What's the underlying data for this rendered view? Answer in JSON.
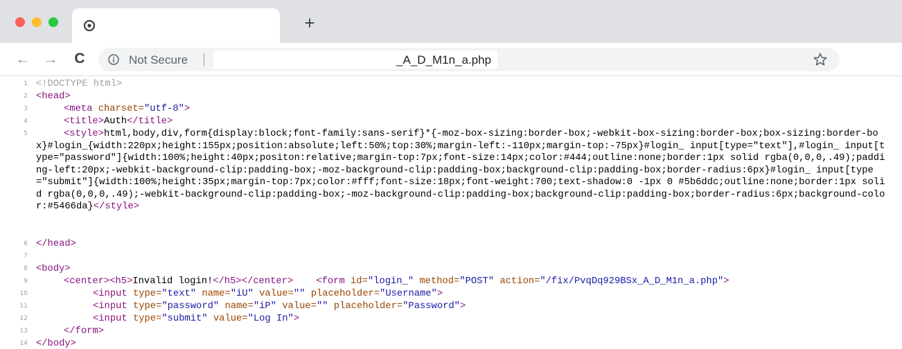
{
  "browser": {
    "new_tab_label": "+",
    "not_secure": "Not Secure",
    "url": "_A_D_M1n_a.php",
    "nav": {
      "back": "←",
      "forward": "→",
      "reload": "C"
    },
    "colors": {
      "red": "#fe5f57",
      "yellow": "#febc2e",
      "green": "#28c840"
    }
  },
  "source": {
    "line_numbers": [
      "1",
      "2",
      "3",
      "4",
      "5",
      "6",
      "7",
      "8",
      "9",
      "10",
      "11",
      "12",
      "13",
      "14"
    ],
    "l1": "<!DOCTYPE html>",
    "l2_tag": "<head>",
    "l3_tag": "<meta",
    "l3_attr": "charset=",
    "l3_val": "\"utf-8\"",
    "l3_end": ">",
    "l4_open": "<title>",
    "l4_text": "Auth",
    "l4_close": "</title>",
    "l5_open": "<style>",
    "l5_css": "html,body,div,form{display:block;font-family:sans-serif}*{-moz-box-sizing:border-box;-webkit-box-sizing:border-box;box-sizing:border-box}#login_{width:220px;height:155px;position:absolute;left:50%;top:30%;margin-left:-110px;margin-top:-75px}#login_ input[type=\"text\"],#login_ input[type=\"password\"]{width:100%;height:40px;positon:relative;margin-top:7px;font-size:14px;color:#444;outline:none;border:1px solid rgba(0,0,0,.49);padding-left:20px;-webkit-background-clip:padding-box;-moz-background-clip:padding-box;background-clip:padding-box;border-radius:6px}#login_ input[type=\"submit\"]{width:100%;height:35px;margin-top:7px;color:#fff;font-size:18px;font-weight:700;text-shadow:0 -1px 0 #5b6ddc;outline:none;border:1px solid rgba(0,0,0,.49);-webkit-background-clip:padding-box;-moz-background-clip:padding-box;background-clip:padding-box;border-radius:6px;background-color:#5466da}",
    "l5_close": "</style>",
    "l6_tag": "</head>",
    "l8_tag": "<body>",
    "l9_center": "<center>",
    "l9_h5": "<h5>",
    "l9_text": "Invalid login!",
    "l9_h5c": "</h5>",
    "l9_centerc": "</center>",
    "l9_form": "<form",
    "l9_id_a": "id=",
    "l9_id_v": "\"login_\"",
    "l9_m_a": "method=",
    "l9_m_v": "\"POST\"",
    "l9_ac_a": "action=",
    "l9_ac_v": "\"/fix/PvqDq929BSx_A_D_M1n_a.php\"",
    "l9_end": ">",
    "l10_tag": "<input",
    "l10_t_a": "type=",
    "l10_t_v": "\"text\"",
    "l10_n_a": "name=",
    "l10_n_v": "\"iU\"",
    "l10_v_a": "value=",
    "l10_v_v": "\"\"",
    "l10_p_a": "placeholder=",
    "l10_p_v": "\"Username\"",
    "l10_end": ">",
    "l11_tag": "<input",
    "l11_t_a": "type=",
    "l11_t_v": "\"password\"",
    "l11_n_a": "name=",
    "l11_n_v": "\"iP\"",
    "l11_v_a": "value=",
    "l11_v_v": "\"\"",
    "l11_p_a": "placeholder=",
    "l11_p_v": "\"Password\"",
    "l11_end": ">",
    "l12_tag": "<input",
    "l12_t_a": "type=",
    "l12_t_v": "\"submit\"",
    "l12_v_a": "value=",
    "l12_v_v": "\"Log In\"",
    "l12_end": ">",
    "l13_tag": "</form>",
    "l14_tag": "</body>"
  }
}
